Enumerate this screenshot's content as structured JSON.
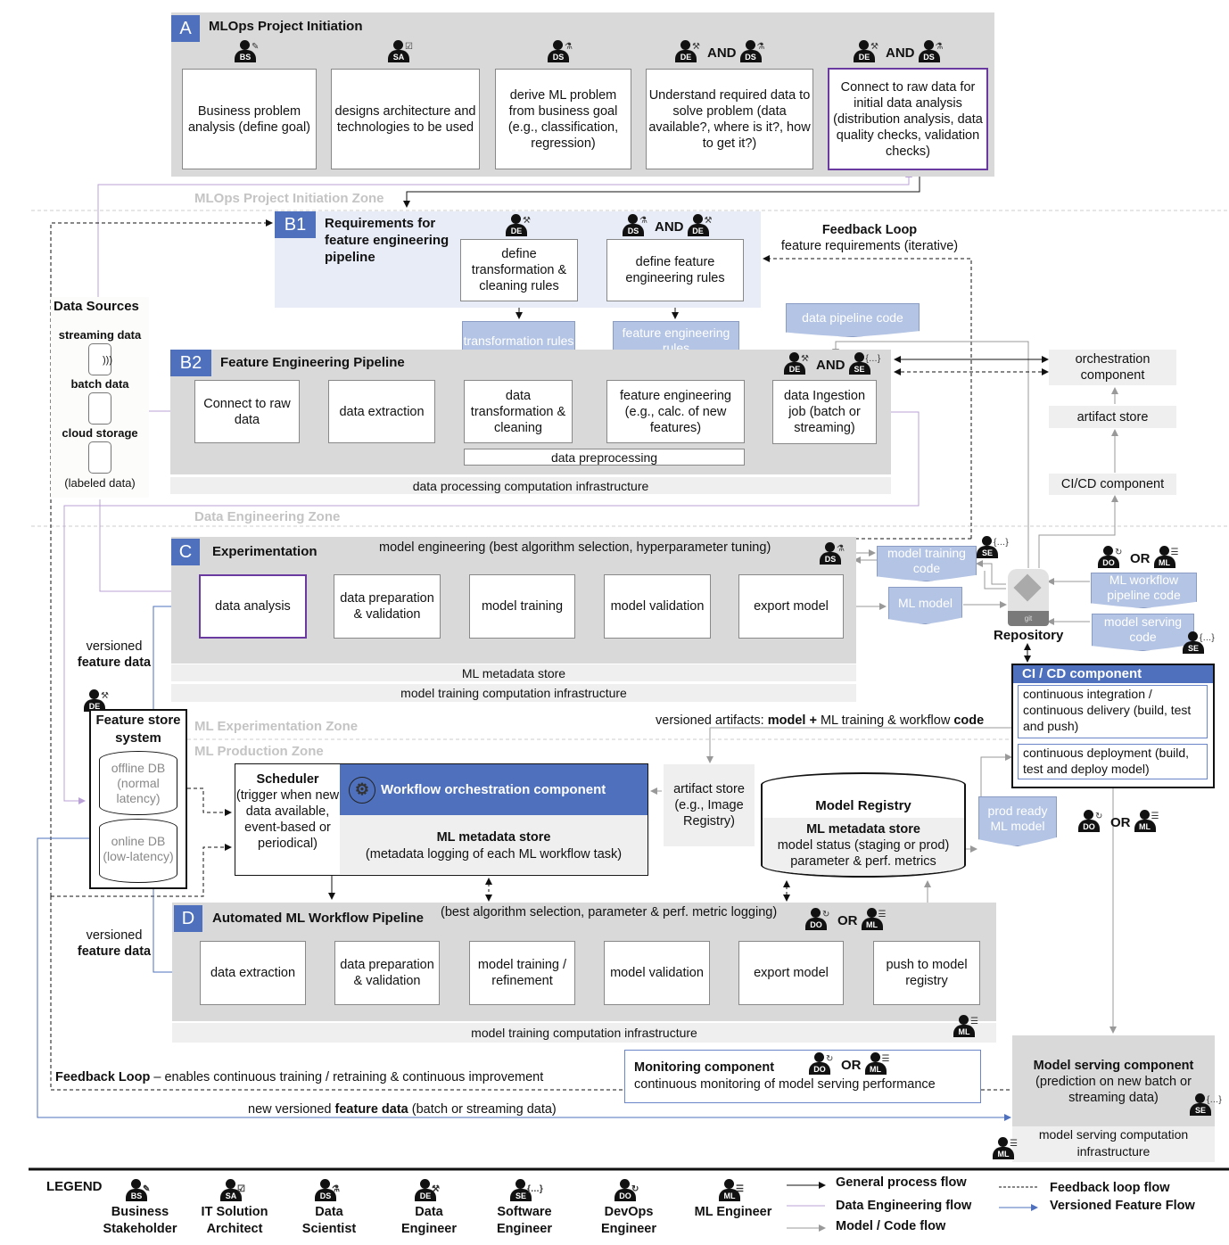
{
  "roles": {
    "BS": {
      "abbr": "BS",
      "name": "Business Stakeholder",
      "acc": "✎"
    },
    "SA": {
      "abbr": "SA",
      "name": "IT Solution Architect",
      "acc": "☑"
    },
    "DS": {
      "abbr": "DS",
      "name": "Data Scientist",
      "acc": "⚗"
    },
    "DE": {
      "abbr": "DE",
      "name": "Data Engineer",
      "acc": "🔧"
    },
    "SE": {
      "abbr": "SE",
      "name": "Software Engineer",
      "acc": "{...}"
    },
    "DO": {
      "abbr": "DO",
      "name": "DevOps Engineer",
      "acc": "↻"
    },
    "ML": {
      "abbr": "ML",
      "name": "ML Engineer",
      "acc": "☰"
    }
  },
  "connectors": {
    "and": "AND",
    "or": "OR"
  },
  "colors": {
    "accent_blue": "#4f71bd",
    "section_gray": "#d9d9d9",
    "doc_blue": "#b4c4e4",
    "purple": "#6a3aa0",
    "data_eng_flow": "#b9a0d6",
    "model_code_flow": "#999999"
  },
  "sectionA": {
    "letter": "A",
    "title": "MLOps Project Initiation",
    "zone": "MLOps Project Initiation Zone",
    "steps": [
      "Business problem analysis (define goal)",
      "designs architecture and technologies to be used",
      "derive ML problem from business goal (e.g., classification, regression)",
      "Understand required data to solve problem (data available?, where is it?, how to get it?)",
      "Connect to raw data for initial data analysis (distribution analysis, data quality checks, validation checks)"
    ]
  },
  "sectionB1": {
    "letter": "B1",
    "title": "Requirements for feature engineering pipeline",
    "steps": [
      "define transformation & cleaning rules",
      "define feature engineering rules"
    ],
    "feedback_title": "Feedback Loop",
    "feedback_sub": "feature requirements (iterative)"
  },
  "artifacts": {
    "transformation_rules": "transformation rules",
    "feature_engineering_rules": "feature engineering rules",
    "data_pipeline_code": "data pipeline code",
    "model_training_code": "model training code",
    "ml_model": "ML model",
    "ml_workflow_pipeline_code": "ML workflow pipeline code",
    "model_serving_code": "model serving code",
    "prod_ready_ml_model": "prod ready ML model"
  },
  "dataSources": {
    "title": "Data Sources",
    "items": [
      "streaming data",
      "batch data",
      "cloud storage"
    ],
    "note": "(labeled data)"
  },
  "sectionB2": {
    "letter": "B2",
    "title": "Feature Engineering Pipeline",
    "steps": [
      "Connect to raw data",
      "data extraction",
      "data transformation & cleaning",
      "feature engineering (e.g., calc. of new features)",
      "data Ingestion job (batch or streaming)"
    ],
    "preprocessing": "data preprocessing",
    "infra": "data processing computation infrastructure",
    "zone": "Data Engineering Zone"
  },
  "rightColumn": {
    "orchestration": "orchestration component",
    "artifact_store": "artifact store",
    "cicd": "CI/CD component",
    "repository": "Repository",
    "git": "git"
  },
  "sectionC": {
    "letter": "C",
    "title": "Experimentation",
    "subtitle": "model engineering (best algorithm selection, hyperparameter tuning)",
    "steps": [
      "data analysis",
      "data preparation & validation",
      "model training",
      "model validation",
      "export model"
    ],
    "metadata": "ML metadata store",
    "infra": "model training computation infrastructure",
    "zone": "ML Experimentation Zone"
  },
  "cicdComponent": {
    "title": "CI / CD component",
    "ci": "continuous integration / continuous delivery (build, test and push)",
    "cd": "continuous deployment (build, test and deploy model)"
  },
  "versionedArtifacts": {
    "prefix": "versioned artifacts: ",
    "bold1": "model +",
    "mid": " ML training & workflow ",
    "bold2": "code"
  },
  "featureStore": {
    "title": "Feature store system",
    "offline": "offline DB (normal latency)",
    "online": "online DB (low-latency)",
    "versioned_pre": "versioned",
    "versioned_bold": "feature data"
  },
  "productionZone": "ML Production Zone",
  "scheduler": {
    "title": "Scheduler",
    "desc": "(trigger when new data available, event-based or periodical)"
  },
  "workflowOrch": {
    "title": "Workflow orchestration component",
    "meta_title": "ML metadata store",
    "meta_desc": "(metadata logging of each ML workflow task)"
  },
  "artifactStore2": "artifact store (e.g., Image Registry)",
  "modelRegistry": {
    "title": "Model Registry",
    "meta_title": "ML metadata store",
    "line1": "model status (staging or prod)",
    "line2": "parameter & perf. metrics"
  },
  "sectionD": {
    "letter": "D",
    "title": "Automated ML Workflow Pipeline",
    "subtitle": "(best algorithm selection, parameter & perf. metric logging)",
    "steps": [
      "data extraction",
      "data preparation & validation",
      "model training / refinement",
      "model validation",
      "export model",
      "push to model registry"
    ],
    "infra": "model training computation infrastructure"
  },
  "feedbackBottom": {
    "bold": "Feedback Loop",
    "text": " – enables continuous training / retraining & continuous improvement"
  },
  "monitoring": {
    "title": "Monitoring component",
    "desc": "continuous monitoring of model serving performance"
  },
  "newFeature": {
    "pre": "new versioned ",
    "bold": "feature data",
    "post": " (batch or streaming data)"
  },
  "modelServing": {
    "title": "Model serving component",
    "desc": "(prediction on new batch or streaming data)",
    "infra": "model serving computation infrastructure"
  },
  "legend": {
    "title": "LEGEND",
    "roles": [
      {
        "abbr": "BS",
        "line1": "Business",
        "line2": "Stakeholder"
      },
      {
        "abbr": "SA",
        "line1": "IT Solution",
        "line2": "Architect"
      },
      {
        "abbr": "DS",
        "line1": "Data",
        "line2": "Scientist"
      },
      {
        "abbr": "DE",
        "line1": "Data",
        "line2": "Engineer"
      },
      {
        "abbr": "SE",
        "line1": "Software",
        "line2": "Engineer"
      },
      {
        "abbr": "DO",
        "line1": "DevOps",
        "line2": "Engineer"
      },
      {
        "abbr": "ML",
        "line1": "ML Engineer",
        "line2": ""
      }
    ],
    "flows": [
      {
        "label": "General process flow",
        "style": "solid",
        "color": "#111111"
      },
      {
        "label": "Data Engineering flow",
        "style": "solid",
        "color": "#b9a0d6"
      },
      {
        "label": "Model / Code flow",
        "style": "solid",
        "color": "#999999"
      },
      {
        "label": "Feedback loop flow",
        "style": "dashed",
        "color": "#111111"
      },
      {
        "label": "Versioned Feature Flow",
        "style": "solid",
        "color": "#4f71bd"
      }
    ]
  }
}
